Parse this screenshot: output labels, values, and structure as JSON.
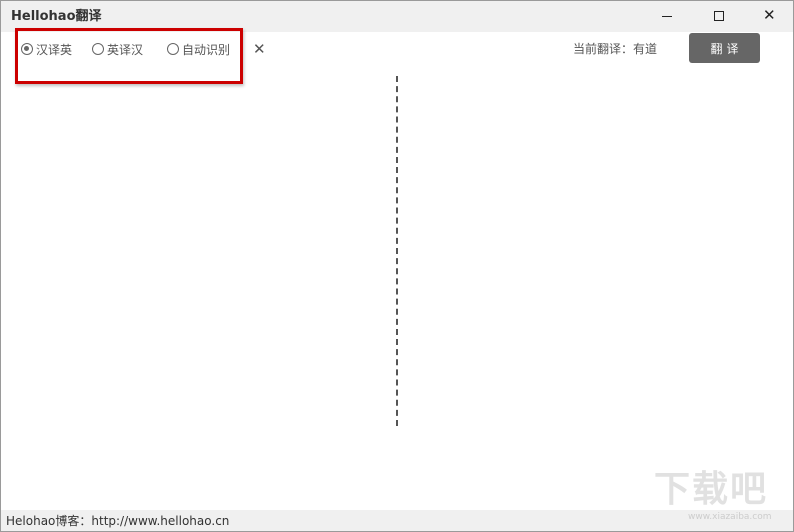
{
  "window": {
    "title": "Hellohao翻译",
    "controls": {
      "minimize": "",
      "maximize": "",
      "close": "✕"
    }
  },
  "options": {
    "modes": [
      {
        "label": "汉译英",
        "checked": true
      },
      {
        "label": "英译汉",
        "checked": false
      },
      {
        "label": "自动识别",
        "checked": false
      }
    ],
    "clear_icon": "✕",
    "engine_label": "当前翻译：有道",
    "translate_button": "翻译"
  },
  "status": {
    "text": "Helohao博客：http://www.hellohao.cn"
  },
  "watermark": {
    "main": "下载吧",
    "sub": "www.xiazaiba.com"
  },
  "colors": {
    "highlight": "#cc0000",
    "button_bg": "#666666",
    "titlebar_bg": "#f0f0f0"
  }
}
